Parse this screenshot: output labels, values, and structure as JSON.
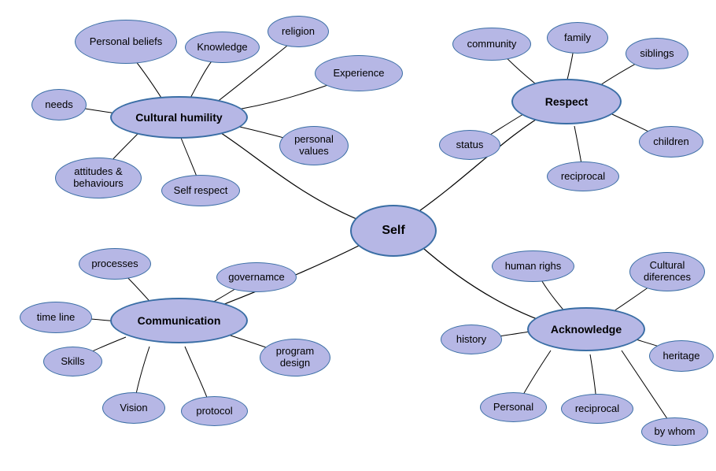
{
  "diagram": {
    "type": "concept-map",
    "central": {
      "id": "self",
      "label": "Self"
    },
    "hubs": [
      {
        "id": "cultural_humility",
        "label": "Cultural humility"
      },
      {
        "id": "respect",
        "label": "Respect"
      },
      {
        "id": "communication",
        "label": "Communication"
      },
      {
        "id": "acknowledge",
        "label": "Acknowledge"
      }
    ],
    "leaves": {
      "cultural_humility": [
        {
          "id": "personal_beliefs",
          "label": "Personal beliefs"
        },
        {
          "id": "knowledge",
          "label": "Knowledge"
        },
        {
          "id": "religion",
          "label": "religion"
        },
        {
          "id": "experience",
          "label": "Experience"
        },
        {
          "id": "needs",
          "label": "needs"
        },
        {
          "id": "personal_values",
          "label": "personal\nvalues"
        },
        {
          "id": "attitudes_behaviours",
          "label": "attitudes &\nbehaviours"
        },
        {
          "id": "self_respect",
          "label": "Self respect"
        }
      ],
      "respect": [
        {
          "id": "community",
          "label": "community"
        },
        {
          "id": "family",
          "label": "family"
        },
        {
          "id": "siblings",
          "label": "siblings"
        },
        {
          "id": "status",
          "label": "status"
        },
        {
          "id": "reciprocal_r",
          "label": "reciprocal"
        },
        {
          "id": "children",
          "label": "children"
        }
      ],
      "communication": [
        {
          "id": "processes",
          "label": "processes"
        },
        {
          "id": "governamce",
          "label": "governamce"
        },
        {
          "id": "time_line",
          "label": "time line"
        },
        {
          "id": "skills",
          "label": "Skills"
        },
        {
          "id": "program_design",
          "label": "program\ndesign"
        },
        {
          "id": "vision",
          "label": "Vision"
        },
        {
          "id": "protocol",
          "label": "protocol"
        }
      ],
      "acknowledge": [
        {
          "id": "human_righs",
          "label": "human righs"
        },
        {
          "id": "cultural_diferences",
          "label": "Cultural\ndiferences"
        },
        {
          "id": "history",
          "label": "history"
        },
        {
          "id": "heritage",
          "label": "heritage"
        },
        {
          "id": "personal",
          "label": "Personal"
        },
        {
          "id": "reciprocal_a",
          "label": "reciprocal"
        },
        {
          "id": "by_whom",
          "label": "by whom"
        }
      ]
    },
    "edges": [
      [
        "self",
        "cultural_humility"
      ],
      [
        "self",
        "respect"
      ],
      [
        "self",
        "communication"
      ],
      [
        "self",
        "acknowledge"
      ],
      [
        "cultural_humility",
        "personal_beliefs"
      ],
      [
        "cultural_humility",
        "knowledge"
      ],
      [
        "cultural_humility",
        "religion"
      ],
      [
        "cultural_humility",
        "experience"
      ],
      [
        "cultural_humility",
        "needs"
      ],
      [
        "cultural_humility",
        "personal_values"
      ],
      [
        "cultural_humility",
        "attitudes_behaviours"
      ],
      [
        "cultural_humility",
        "self_respect"
      ],
      [
        "respect",
        "community"
      ],
      [
        "respect",
        "family"
      ],
      [
        "respect",
        "siblings"
      ],
      [
        "respect",
        "status"
      ],
      [
        "respect",
        "reciprocal_r"
      ],
      [
        "respect",
        "children"
      ],
      [
        "communication",
        "processes"
      ],
      [
        "communication",
        "governamce"
      ],
      [
        "communication",
        "time_line"
      ],
      [
        "communication",
        "skills"
      ],
      [
        "communication",
        "program_design"
      ],
      [
        "communication",
        "vision"
      ],
      [
        "communication",
        "protocol"
      ],
      [
        "acknowledge",
        "human_righs"
      ],
      [
        "acknowledge",
        "cultural_diferences"
      ],
      [
        "acknowledge",
        "history"
      ],
      [
        "acknowledge",
        "heritage"
      ],
      [
        "acknowledge",
        "personal"
      ],
      [
        "acknowledge",
        "reciprocal_a"
      ],
      [
        "acknowledge",
        "by_whom"
      ]
    ]
  },
  "colors": {
    "node_fill": "#b6b7e5",
    "node_stroke": "#3a6ea5",
    "edge_stroke": "#000000"
  }
}
